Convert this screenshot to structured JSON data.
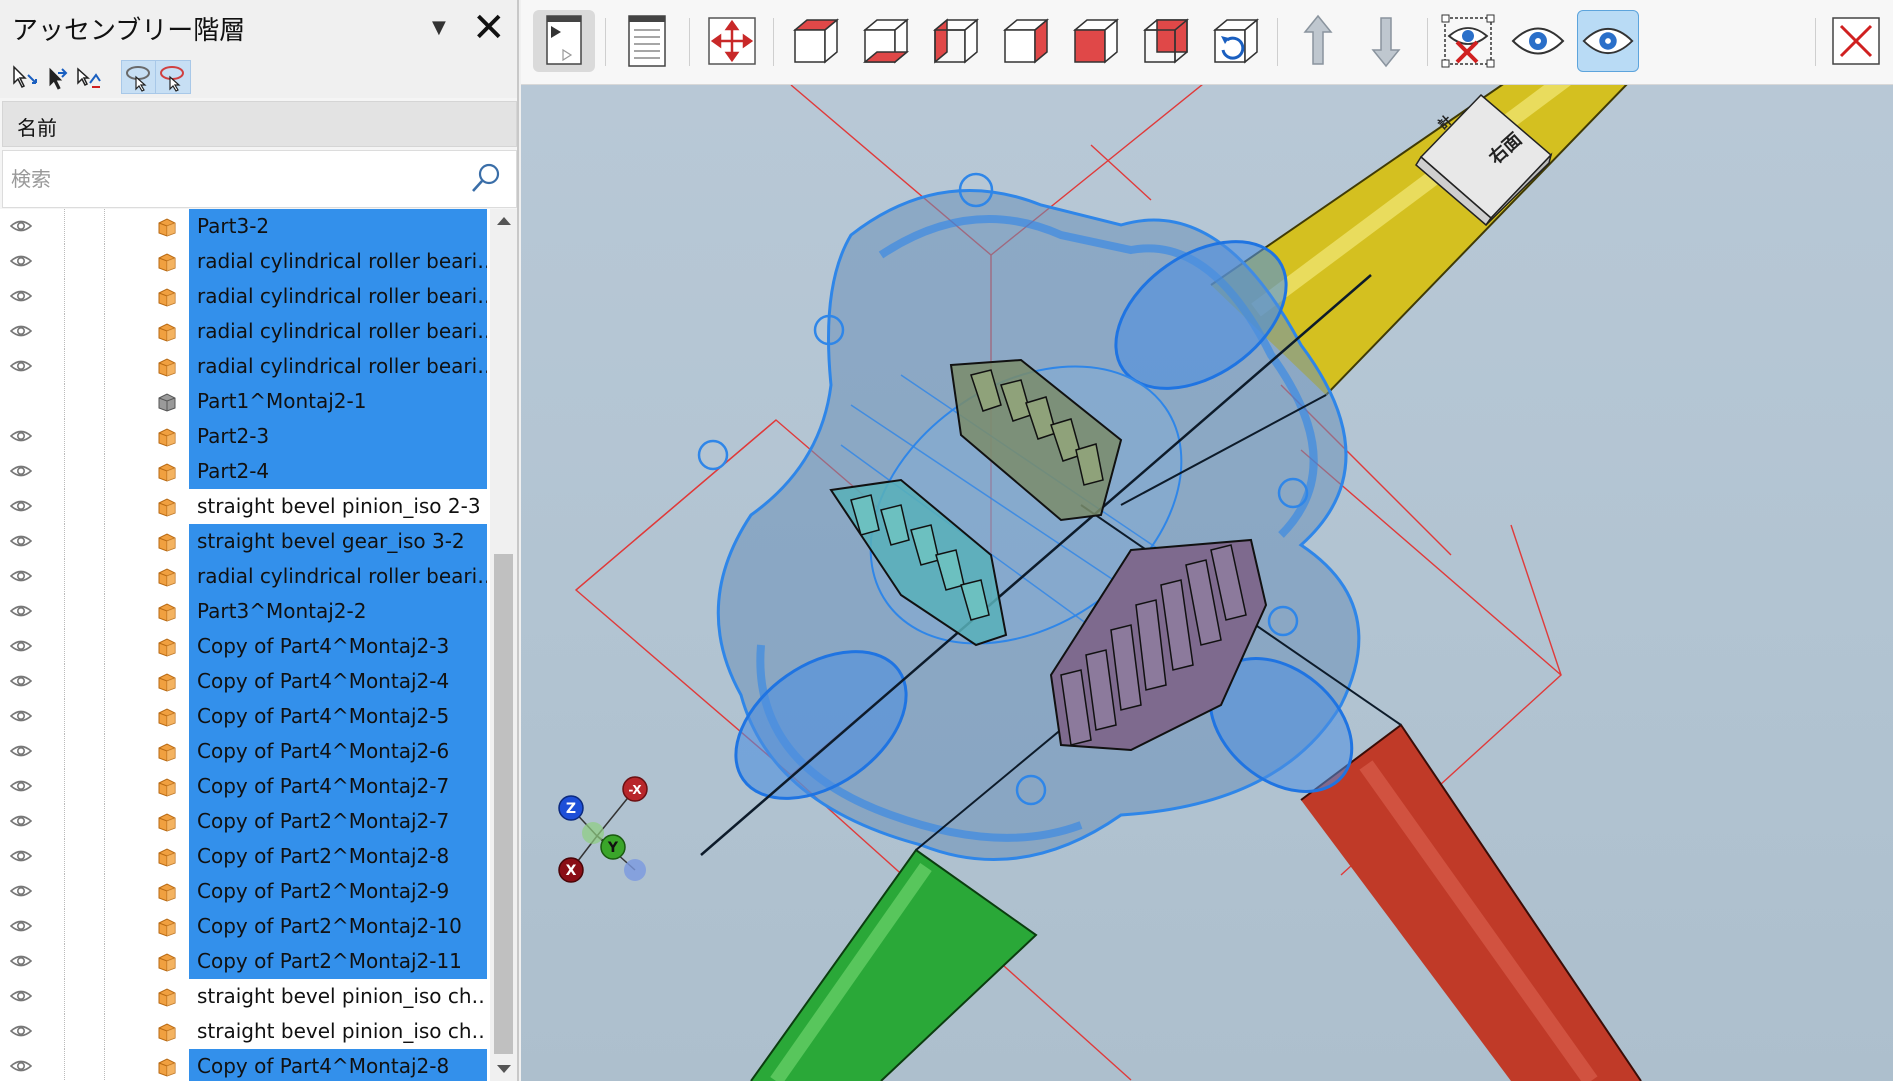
{
  "panel": {
    "title": "アッセンブリー階層",
    "column_header": "名前",
    "search_placeholder": "検索",
    "tree_items": [
      {
        "label": "Part3-2",
        "selected": true,
        "visible": true,
        "icon": "part-icon"
      },
      {
        "label": "radial cylindrical roller beari…",
        "selected": true,
        "visible": true,
        "icon": "part-icon"
      },
      {
        "label": "radial cylindrical roller beari…",
        "selected": true,
        "visible": true,
        "icon": "part-icon"
      },
      {
        "label": "radial cylindrical roller beari…",
        "selected": true,
        "visible": true,
        "icon": "part-icon"
      },
      {
        "label": "radial cylindrical roller beari…",
        "selected": true,
        "visible": true,
        "icon": "part-icon"
      },
      {
        "label": "Part1^Montaj2-1",
        "selected": true,
        "visible": false,
        "icon": "hidden-part-icon"
      },
      {
        "label": "Part2-3",
        "selected": true,
        "visible": true,
        "icon": "part-icon"
      },
      {
        "label": "Part2-4",
        "selected": true,
        "visible": true,
        "icon": "part-icon"
      },
      {
        "label": "straight bevel pinion_iso 2-3",
        "selected": false,
        "visible": true,
        "icon": "part-icon"
      },
      {
        "label": "straight bevel gear_iso 3-2",
        "selected": true,
        "visible": true,
        "icon": "part-icon"
      },
      {
        "label": "radial cylindrical roller beari…",
        "selected": true,
        "visible": true,
        "icon": "part-icon"
      },
      {
        "label": "Part3^Montaj2-2",
        "selected": true,
        "visible": true,
        "icon": "part-icon"
      },
      {
        "label": "Copy of Part4^Montaj2-3",
        "selected": true,
        "visible": true,
        "icon": "part-icon"
      },
      {
        "label": "Copy of Part4^Montaj2-4",
        "selected": true,
        "visible": true,
        "icon": "part-icon"
      },
      {
        "label": "Copy of Part4^Montaj2-5",
        "selected": true,
        "visible": true,
        "icon": "part-icon"
      },
      {
        "label": "Copy of Part4^Montaj2-6",
        "selected": true,
        "visible": true,
        "icon": "part-icon"
      },
      {
        "label": "Copy of Part4^Montaj2-7",
        "selected": true,
        "visible": true,
        "icon": "part-icon"
      },
      {
        "label": "Copy of Part2^Montaj2-7",
        "selected": true,
        "visible": true,
        "icon": "part-icon"
      },
      {
        "label": "Copy of Part2^Montaj2-8",
        "selected": true,
        "visible": true,
        "icon": "part-icon"
      },
      {
        "label": "Copy of Part2^Montaj2-9",
        "selected": true,
        "visible": true,
        "icon": "part-icon"
      },
      {
        "label": "Copy of Part2^Montaj2-10",
        "selected": true,
        "visible": true,
        "icon": "part-icon"
      },
      {
        "label": "Copy of Part2^Montaj2-11",
        "selected": true,
        "visible": true,
        "icon": "part-icon"
      },
      {
        "label": "straight bevel pinion_iso ch…",
        "selected": false,
        "visible": true,
        "icon": "part-icon"
      },
      {
        "label": "straight bevel pinion_iso ch…",
        "selected": false,
        "visible": true,
        "icon": "part-icon"
      },
      {
        "label": "Copy of Part4^Montaj2-8",
        "selected": true,
        "visible": true,
        "icon": "part-icon"
      }
    ]
  },
  "viewcube": {
    "face_label": "右面",
    "top_label": "計"
  },
  "triad": {
    "z": "Z",
    "neg_x": "-X",
    "y": "Y",
    "x": "X"
  },
  "colors": {
    "selection": "#3390eb",
    "part_orange": "#f0a040",
    "shaft_yellow": "#d4c020",
    "shaft_green": "#2aa838",
    "shaft_red": "#c03a28",
    "highlight_blue": "#2f86e8"
  }
}
